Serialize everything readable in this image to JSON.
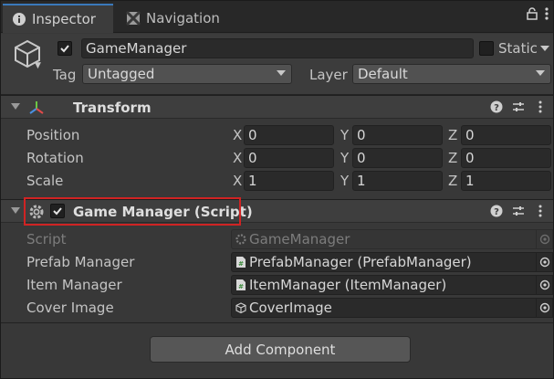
{
  "tabs": [
    {
      "label": "Inspector",
      "icon": "info-icon",
      "active": true
    },
    {
      "label": "Navigation",
      "icon": "navigation-icon",
      "active": false
    }
  ],
  "header": {
    "object_name": "GameManager",
    "static_label": "Static",
    "tag_label": "Tag",
    "tag_value": "Untagged",
    "layer_label": "Layer",
    "layer_value": "Default"
  },
  "transform": {
    "title": "Transform",
    "rows": [
      {
        "label": "Position",
        "x": "0",
        "y": "0",
        "z": "0"
      },
      {
        "label": "Rotation",
        "x": "0",
        "y": "0",
        "z": "0"
      },
      {
        "label": "Scale",
        "x": "1",
        "y": "1",
        "z": "1"
      }
    ],
    "axis": {
      "x": "X",
      "y": "Y",
      "z": "Z"
    }
  },
  "script_component": {
    "title": "Game Manager (Script)",
    "fields": [
      {
        "label": "Script",
        "value": "GameManager"
      },
      {
        "label": "Prefab Manager",
        "value": "PrefabManager (PrefabManager)"
      },
      {
        "label": "Item Manager",
        "value": "ItemManager (ItemManager)"
      },
      {
        "label": "Cover Image",
        "value": "CoverImage"
      }
    ]
  },
  "add_component_label": "Add Component",
  "colors": {
    "accent": "#3a79bb",
    "highlight": "#d02323",
    "background": "#383838"
  }
}
